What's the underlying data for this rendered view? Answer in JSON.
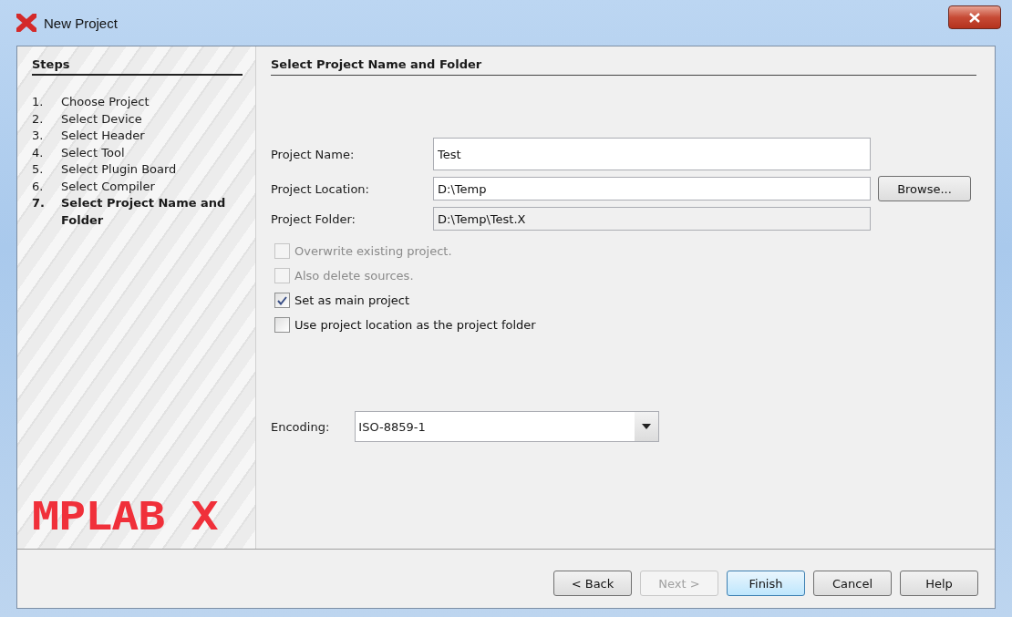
{
  "window": {
    "title": "New Project"
  },
  "steps": {
    "title": "Steps",
    "items": [
      {
        "number": "1.",
        "label": "Choose Project",
        "selected": false
      },
      {
        "number": "2.",
        "label": "Select Device",
        "selected": false
      },
      {
        "number": "3.",
        "label": "Select Header",
        "selected": false
      },
      {
        "number": "4.",
        "label": "Select Tool",
        "selected": false
      },
      {
        "number": "5.",
        "label": "Select Plugin Board",
        "selected": false
      },
      {
        "number": "6.",
        "label": "Select Compiler",
        "selected": false
      },
      {
        "number": "7.",
        "label": "Select Project Name and Folder",
        "selected": true
      }
    ]
  },
  "logo": "MPLAB X",
  "panel": {
    "title": "Select Project Name and Folder",
    "fields": [
      {
        "label": "Project Name:",
        "value": "Test",
        "disabled": false
      },
      {
        "label": "Project Location:",
        "value": "D:\\Temp",
        "disabled": false,
        "button": "Browse..."
      },
      {
        "label": "Project Folder:",
        "value": "D:\\Temp\\Test.X",
        "disabled": true
      }
    ],
    "checkboxes": [
      {
        "label": "Overwrite existing project.",
        "checked": false,
        "disabled": true
      },
      {
        "label": "Also delete sources.",
        "checked": false,
        "disabled": true
      },
      {
        "label": "Set as main project",
        "checked": true,
        "disabled": false
      },
      {
        "label": "Use project location as the project folder",
        "checked": false,
        "disabled": false
      }
    ],
    "encoding": {
      "label": "Encoding:",
      "value": "ISO-8859-1"
    }
  },
  "buttons": [
    {
      "label": "< Back",
      "disabled": false,
      "default": false
    },
    {
      "label": "Next >",
      "disabled": true,
      "default": false
    },
    {
      "label": "Finish",
      "disabled": false,
      "default": true
    },
    {
      "label": "Cancel",
      "disabled": false,
      "default": false
    },
    {
      "label": "Help",
      "disabled": false,
      "default": false
    }
  ]
}
